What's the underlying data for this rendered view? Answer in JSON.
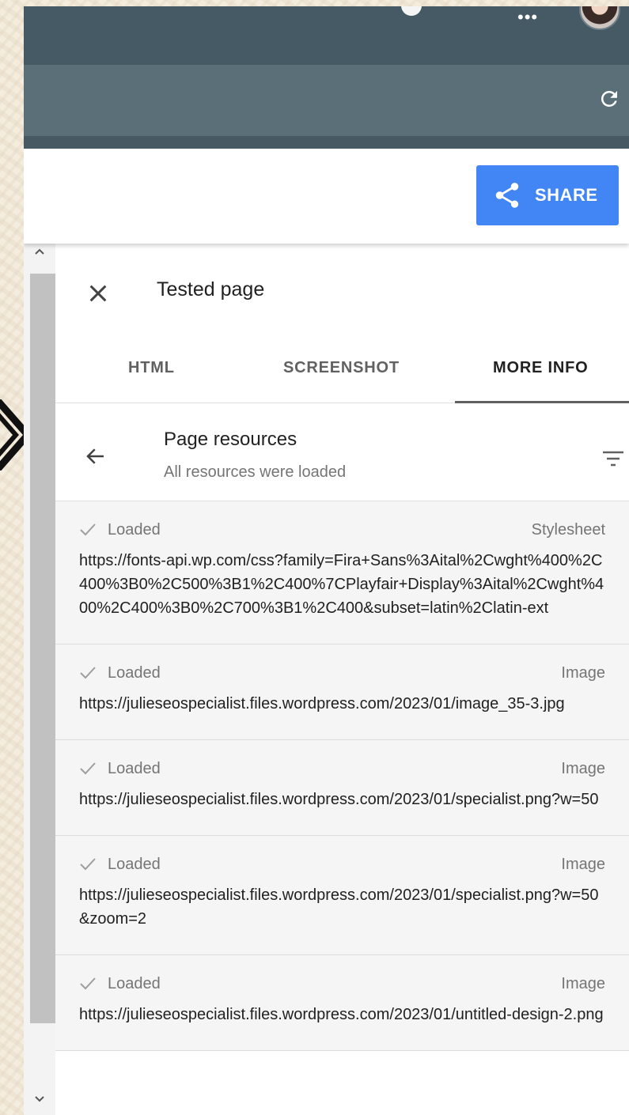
{
  "share": {
    "label": "SHARE"
  },
  "panel": {
    "title": "Tested page",
    "tabs": [
      {
        "label": "HTML"
      },
      {
        "label": "SCREENSHOT"
      },
      {
        "label": "MORE INFO"
      }
    ],
    "active_tab": "MORE INFO"
  },
  "resources": {
    "title": "Page resources",
    "subtitle": "All resources were loaded",
    "items": [
      {
        "status": "Loaded",
        "type": "Stylesheet",
        "url": "https://fonts-api.wp.com/css?family=Fira+Sans%3Aital%2Cwght%400%2C400%3B0%2C500%3B1%2C400%7CPlayfair+Display%3Aital%2Cwght%400%2C400%3B0%2C700%3B1%2C400&subset=latin%2Clatin-ext"
      },
      {
        "status": "Loaded",
        "type": "Image",
        "url": "https://julieseospecialist.files.wordpress.com/2023/01/image_35-3.jpg"
      },
      {
        "status": "Loaded",
        "type": "Image",
        "url": "https://julieseospecialist.files.wordpress.com/2023/01/specialist.png?w=50"
      },
      {
        "status": "Loaded",
        "type": "Image",
        "url": "https://julieseospecialist.files.wordpress.com/2023/01/specialist.png?w=50&zoom=2"
      },
      {
        "status": "Loaded",
        "type": "Image",
        "url": "https://julieseospecialist.files.wordpress.com/2023/01/untitled-design-2.png"
      }
    ]
  },
  "colors": {
    "topbar": "#455a64",
    "subbar": "#5b6f79",
    "share_button": "#4285f4",
    "list_background": "#f5f5f5"
  },
  "icons": {
    "close": "close-icon",
    "back": "arrow-left-icon",
    "filter": "filter-icon",
    "check": "check-icon",
    "share": "share-icon",
    "refresh": "refresh-icon"
  }
}
